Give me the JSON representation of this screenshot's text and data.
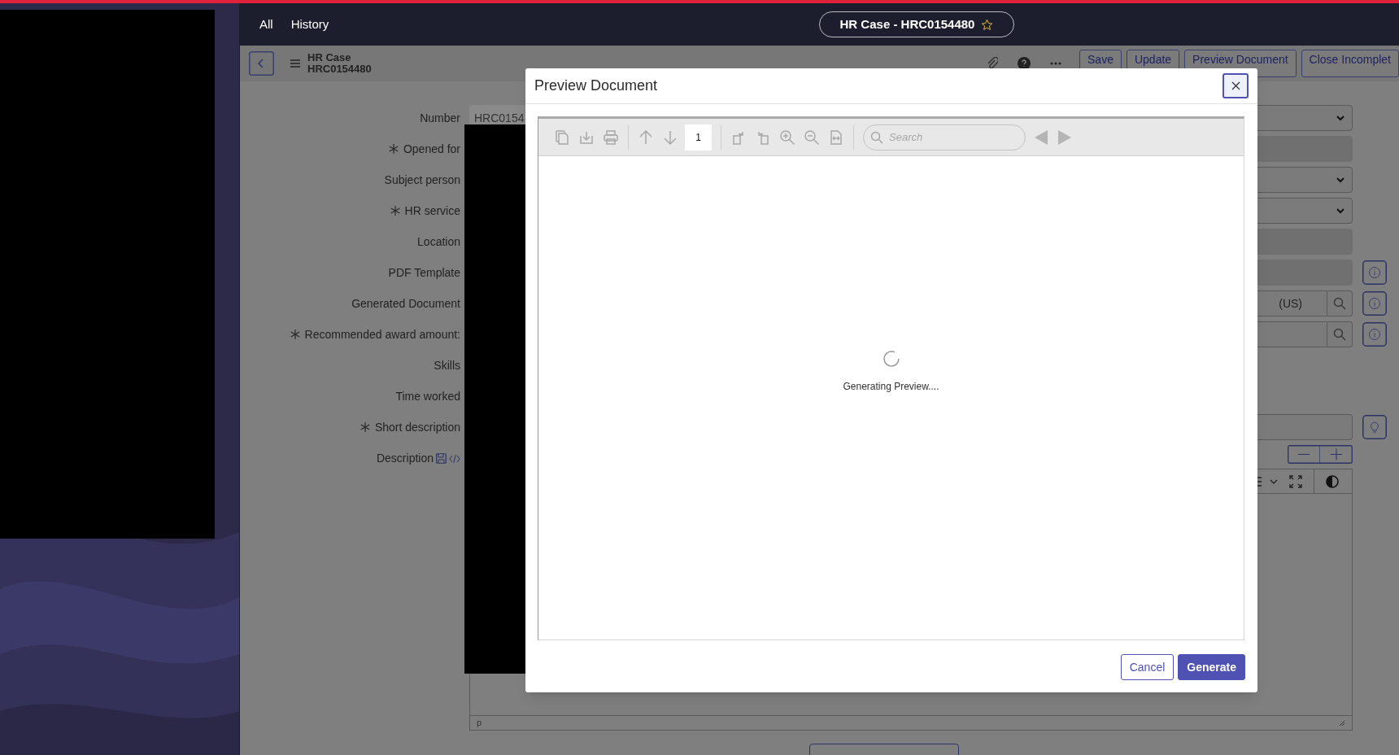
{
  "top_nav": {
    "items": [
      {
        "label": "All"
      },
      {
        "label": "History"
      }
    ],
    "record_pill": {
      "title": "HR Case - HRC0154480",
      "starred": false
    }
  },
  "header": {
    "table": "HR Case",
    "number": "HRC0154480",
    "actions": [
      "Save",
      "Update",
      "Preview Document",
      "Close Incomplet"
    ]
  },
  "form": {
    "rows": [
      {
        "label": "Number",
        "mandatory": false,
        "value": "HRC0154",
        "right_field": {
          "kind": "select"
        }
      },
      {
        "label": "Opened for",
        "mandatory": true,
        "right_field": {
          "kind": "readonly"
        }
      },
      {
        "label": "Subject person",
        "mandatory": false,
        "right_field": {
          "kind": "select"
        }
      },
      {
        "label": "HR service",
        "mandatory": true,
        "right_field": {
          "kind": "select"
        }
      },
      {
        "label": "Location",
        "mandatory": false,
        "right_field": {
          "kind": "readonly"
        }
      },
      {
        "label": "PDF Template",
        "mandatory": false,
        "right_field": {
          "kind": "readonly",
          "button": {
            "kind": "info"
          }
        }
      },
      {
        "label": "Generated Document",
        "mandatory": false,
        "right_field": {
          "kind": "reference",
          "value": "(US)",
          "button": {
            "kind": "info"
          }
        }
      },
      {
        "label": "Recommended award amount:",
        "mandatory": true,
        "right_field": {
          "kind": "reference",
          "button": {
            "kind": "info"
          }
        }
      },
      {
        "label": "Skills",
        "mandatory": false
      },
      {
        "label": "Time worked",
        "mandatory": false
      },
      {
        "label": "Short description",
        "mandatory": true,
        "right_field": {
          "kind": "text",
          "button": {
            "kind": "hint"
          }
        }
      }
    ],
    "description": {
      "label": "Description",
      "mandatory": false,
      "status": "p"
    }
  },
  "modal": {
    "title": "Preview Document",
    "viewer": {
      "page": "1",
      "search_placeholder": "Search",
      "message": "Generating Preview...."
    },
    "buttons": [
      {
        "label": "Cancel",
        "kind": "secondary"
      },
      {
        "label": "Generate",
        "kind": "primary"
      }
    ]
  }
}
